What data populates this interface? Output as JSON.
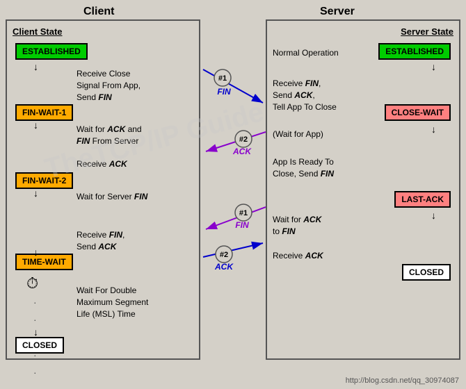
{
  "titles": {
    "client": "Client",
    "server": "Server",
    "client_state": "Client State",
    "server_state": "Server State"
  },
  "client_states": {
    "established": "ESTABLISHED",
    "fin_wait_1": "FIN-WAIT-1",
    "fin_wait_2": "FIN-WAIT-2",
    "time_wait": "TIME-WAIT",
    "closed": "CLOSED"
  },
  "server_states": {
    "established": "ESTABLISHED",
    "close_wait": "CLOSE-WAIT",
    "last_ack": "LAST-ACK",
    "closed": "CLOSED"
  },
  "client_descriptions": {
    "d1": "Receive Close\nSignal From App,\nSend FIN",
    "d2": "Wait for ACK and\nFIN From Server",
    "d3": "Receive ACK",
    "d4": "Wait for Server FIN",
    "d5": "Receive FIN,\nSend ACK",
    "d6": "Wait For Double\nMaximum Segment\nLife (MSL) Time"
  },
  "server_descriptions": {
    "d1": "Normal Operation",
    "d2": "Receive FIN,\nSend ACK,\nTell App To Close",
    "d3": "(Wait for App)",
    "d4": "App Is Ready To\nClose, Send FIN",
    "d5": "Wait for ACK\nto FIN",
    "d6": "Receive ACK"
  },
  "arrows": {
    "fin1_label": "FIN",
    "ack2_label": "ACK",
    "fin1_server_label": "FIN",
    "ack2_client_label": "ACK"
  },
  "watermark": "TheTCP/IP Guide",
  "url": "http://blog.csdn.net/qq_30974087"
}
